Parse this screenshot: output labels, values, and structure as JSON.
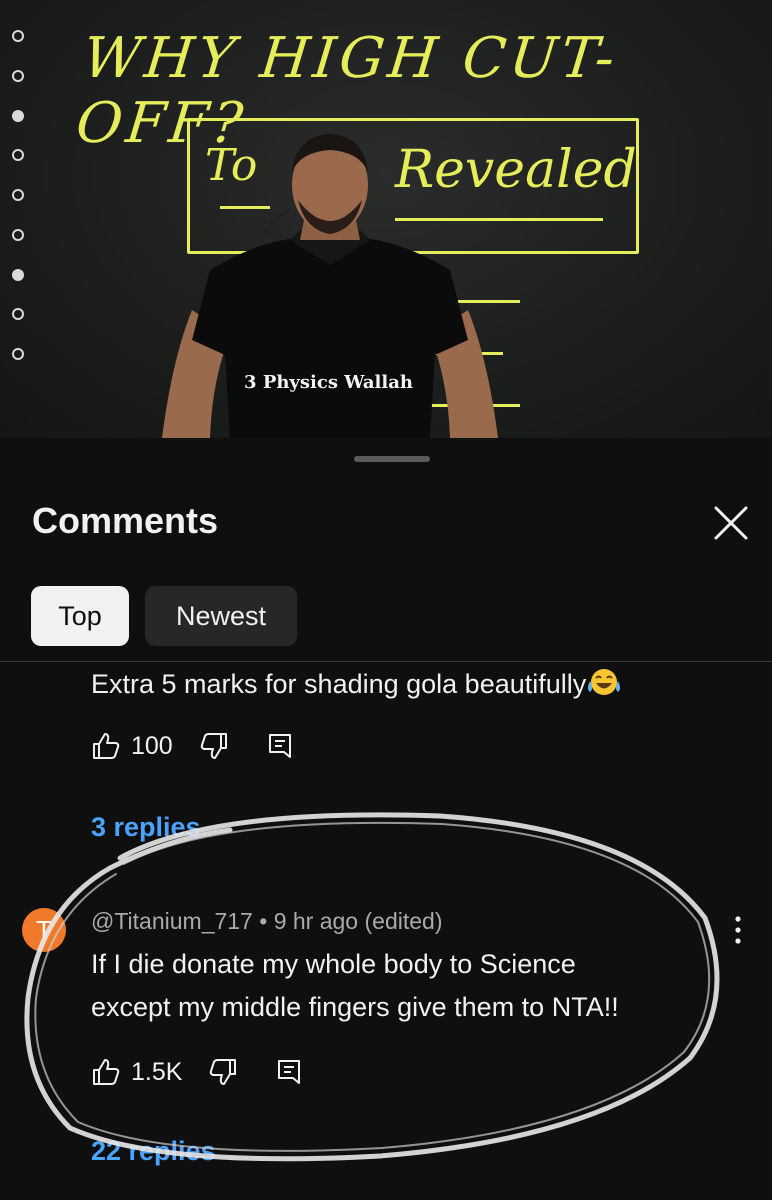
{
  "video": {
    "board_title": "WHY HIGH CUT-OFF?",
    "board_to": "To",
    "board_revealed": "Revealed",
    "tshirt_text": "Physics Wallah",
    "tshirt_prefix": "3"
  },
  "sheet": {
    "title": "Comments",
    "close_icon": "close-icon",
    "chips": {
      "top": "Top",
      "newest": "Newest"
    }
  },
  "comments": [
    {
      "text": "Extra 5 marks for shading gola beautifully",
      "emoji": "laughing-tears-emoji",
      "likes": "100",
      "replies": "3 replies"
    },
    {
      "avatar_letter": "T",
      "author": "@Titanium_717",
      "separator": "•",
      "time": "9 hr ago (edited)",
      "text_line1": "If I die donate my whole body to Science",
      "text_line2": "except my middle fingers give them to NTA!!",
      "likes": "1.5K",
      "replies": "22 replies"
    }
  ],
  "colors": {
    "background": "#0f0f0f",
    "link": "#4aa3ff",
    "chalk": "#e6ec5a",
    "avatar": "#f07a2a"
  }
}
